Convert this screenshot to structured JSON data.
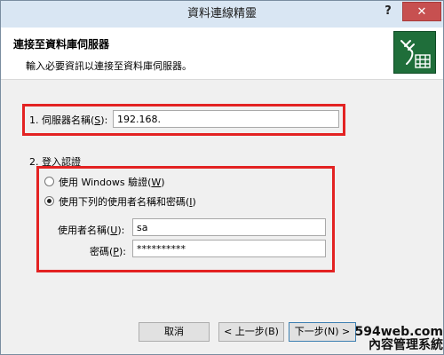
{
  "window": {
    "title": "資料連線精靈"
  },
  "titlebar": {
    "help": "?",
    "close": "✕"
  },
  "header": {
    "title": "連接至資料庫伺服器",
    "subtitle": "輸入必要資訊以連接至資料庫伺服器。"
  },
  "server": {
    "label": "1. 伺服器名稱(",
    "hotkey": "S",
    "label_end": "):",
    "value": "192.168."
  },
  "auth": {
    "label": "2. 登入認證",
    "windows_option": {
      "text": "使用 Windows 驗證(",
      "hotkey": "W",
      "end": ")",
      "checked": false
    },
    "sql_option": {
      "text": "使用下列的使用者名稱和密碼(",
      "hotkey": "I",
      "end": ")",
      "checked": true
    },
    "username": {
      "label": "使用者名稱(",
      "hotkey": "U",
      "label_end": "):",
      "value": "sa"
    },
    "password": {
      "label": "密碼(",
      "hotkey": "P",
      "label_end": "):",
      "value": "**********"
    }
  },
  "buttons": {
    "cancel": "取消",
    "back": "< 上一步(B)",
    "next": "下一步(N) >"
  },
  "watermark": {
    "line1": "594web.com",
    "line2": "內容管理系統"
  },
  "colors": {
    "highlight": "#e32222",
    "titlebar": "#d9e6f3",
    "close": "#c75050"
  }
}
